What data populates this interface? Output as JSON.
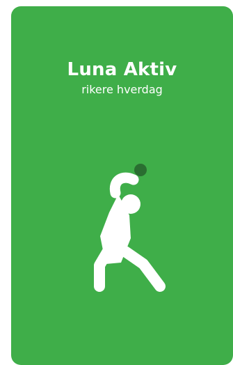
{
  "card": {
    "background_color": "#3fae49",
    "title": "Luna Aktiv",
    "subtitle": "rikere hverdag",
    "illustration": "stretching-person-icon"
  }
}
